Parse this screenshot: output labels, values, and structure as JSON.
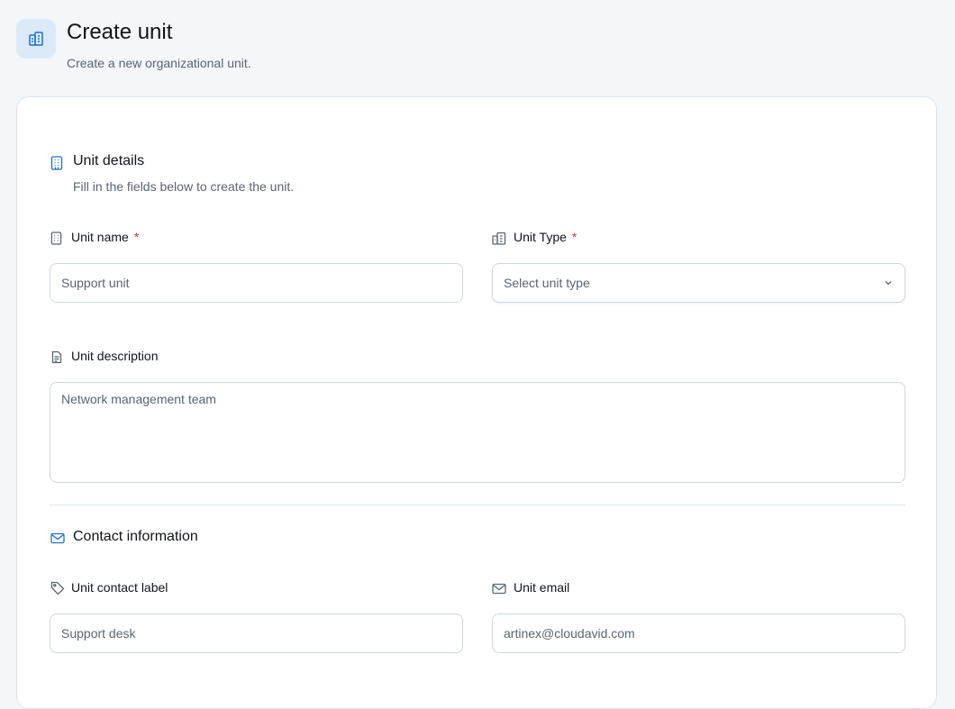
{
  "header": {
    "title": "Create unit",
    "subtitle": "Create a new organizational unit.",
    "icon": "building-icon"
  },
  "unit_details": {
    "title": "Unit details",
    "description": "Fill in the fields below to create the unit.",
    "unit_name": {
      "label": "Unit name",
      "required_mark": "*",
      "placeholder": "Support unit"
    },
    "unit_type": {
      "label": "Unit Type",
      "required_mark": "*",
      "selected": "Select unit type"
    },
    "unit_description": {
      "label": "Unit description",
      "placeholder": "Network management team"
    }
  },
  "contact": {
    "title": "Contact information",
    "contact_label": {
      "label": "Unit contact label",
      "placeholder": "Support desk"
    },
    "email": {
      "label": "Unit email",
      "placeholder": "artinex@cloudavid.com"
    }
  },
  "colors": {
    "accent": "#1a73c8",
    "required": "#d32f2f",
    "icon_muted": "#5a6470"
  }
}
